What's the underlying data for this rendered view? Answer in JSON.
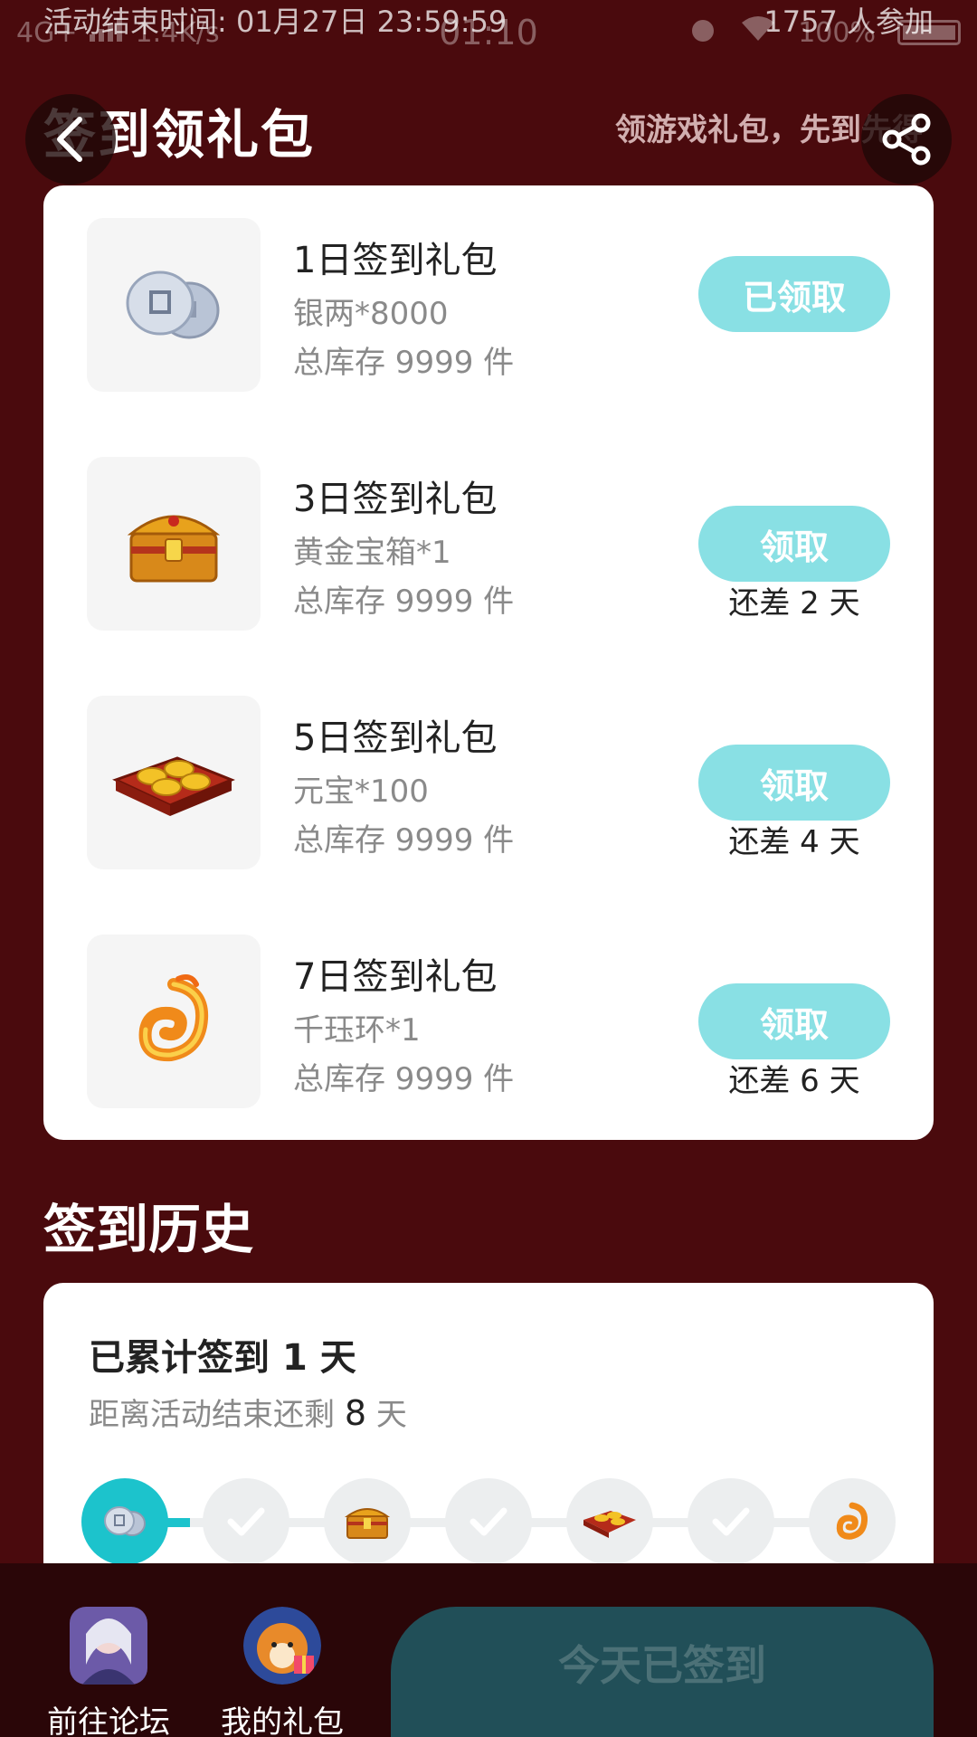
{
  "status_bar": {
    "network": "4G+",
    "speed": "1.4K/s",
    "time": "01:10",
    "battery": "100%"
  },
  "activity": {
    "end_time": "活动结束时间: 01月27日 23:59:59",
    "participants": "1757 人参加"
  },
  "header": {
    "title": "签到领礼包",
    "slogan": "领游戏礼包，先到先得"
  },
  "gifts": [
    {
      "name": "1日签到礼包",
      "content": "银两*8000",
      "stock": "总库存 9999 件",
      "button": "已领取",
      "days_left": "",
      "icon": "silver-coins-icon"
    },
    {
      "name": "3日签到礼包",
      "content": "黄金宝箱*1",
      "stock": "总库存 9999 件",
      "button": "领取",
      "days_left": "还差 2 天",
      "icon": "gold-chest-icon"
    },
    {
      "name": "5日签到礼包",
      "content": "元宝*100",
      "stock": "总库存 9999 件",
      "button": "领取",
      "days_left": "还差 4 天",
      "icon": "gold-ingots-icon"
    },
    {
      "name": "7日签到礼包",
      "content": "千珏环*1",
      "stock": "总库存 9999 件",
      "button": "领取",
      "days_left": "还差 6 天",
      "icon": "fire-ring-icon"
    }
  ],
  "history": {
    "title": "签到历史",
    "accum_prefix": "已累计签到",
    "accum_days": "1",
    "accum_suffix": "天",
    "remain_prefix": "距离活动结束还剩",
    "remain_days": "8",
    "remain_suffix": "天",
    "timeline": [
      "silver-coins-icon",
      "check-icon",
      "gold-chest-icon",
      "check-icon",
      "gold-ingots-icon",
      "check-icon",
      "fire-ring-icon"
    ]
  },
  "bottom": {
    "forum_label": "前往论坛",
    "gifts_label": "我的礼包",
    "signed_label": "今天已签到"
  },
  "colors": {
    "background": "#4a0a0d",
    "accent": "#89e0e4",
    "active": "#1cc3cc"
  }
}
